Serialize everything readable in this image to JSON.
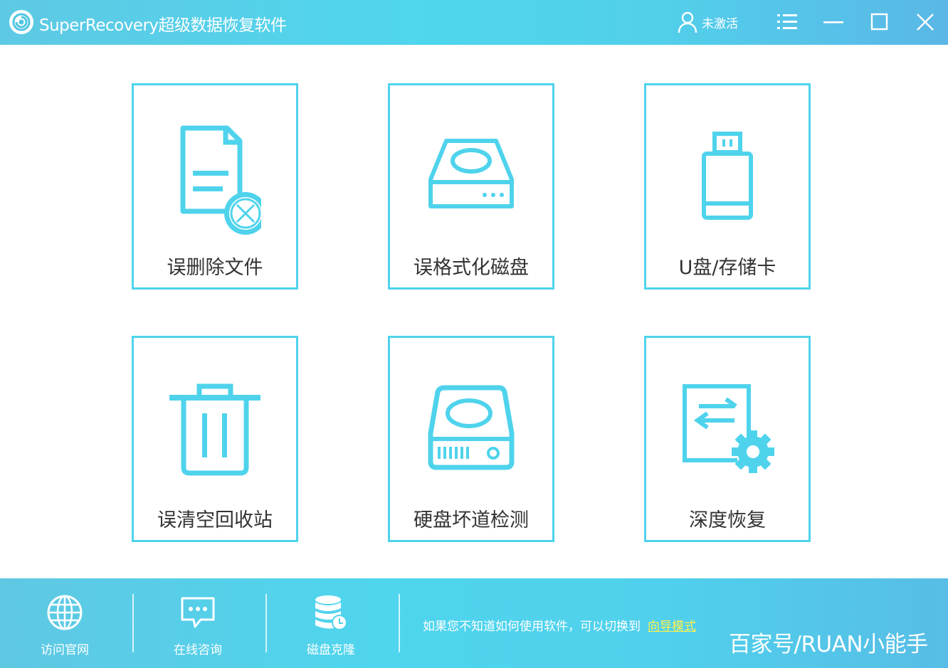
{
  "window": {
    "title": "SuperRecovery超级数据恢复软件",
    "user_status": "未激活",
    "accent_color": "#4fd3ec",
    "icons": [
      "logo-icon",
      "user-icon",
      "menu-icon",
      "minimize-icon",
      "maximize-icon",
      "close-icon"
    ]
  },
  "tiles": [
    {
      "label": "误删除文件",
      "icon": "deleted-file-icon"
    },
    {
      "label": "误格式化磁盘",
      "icon": "disk-icon"
    },
    {
      "label": "U盘/存储卡",
      "icon": "usb-drive-icon"
    },
    {
      "label": "误清空回收站",
      "icon": "trash-icon"
    },
    {
      "label": "硬盘坏道检测",
      "icon": "hard-drive-icon"
    },
    {
      "label": "深度恢复",
      "icon": "deep-recovery-icon"
    }
  ],
  "bottom": {
    "items": [
      {
        "label": "访问官网",
        "icon": "globe-icon"
      },
      {
        "label": "在线咨询",
        "icon": "chat-icon"
      },
      {
        "label": "磁盘克隆",
        "icon": "database-clone-icon"
      }
    ],
    "hint_text": "如果您不知道如何使用软件，可以切换到",
    "hint_link": "向导模式",
    "hint_link_color": "#fff34d"
  },
  "watermark": "百家号/RUAN小能手"
}
